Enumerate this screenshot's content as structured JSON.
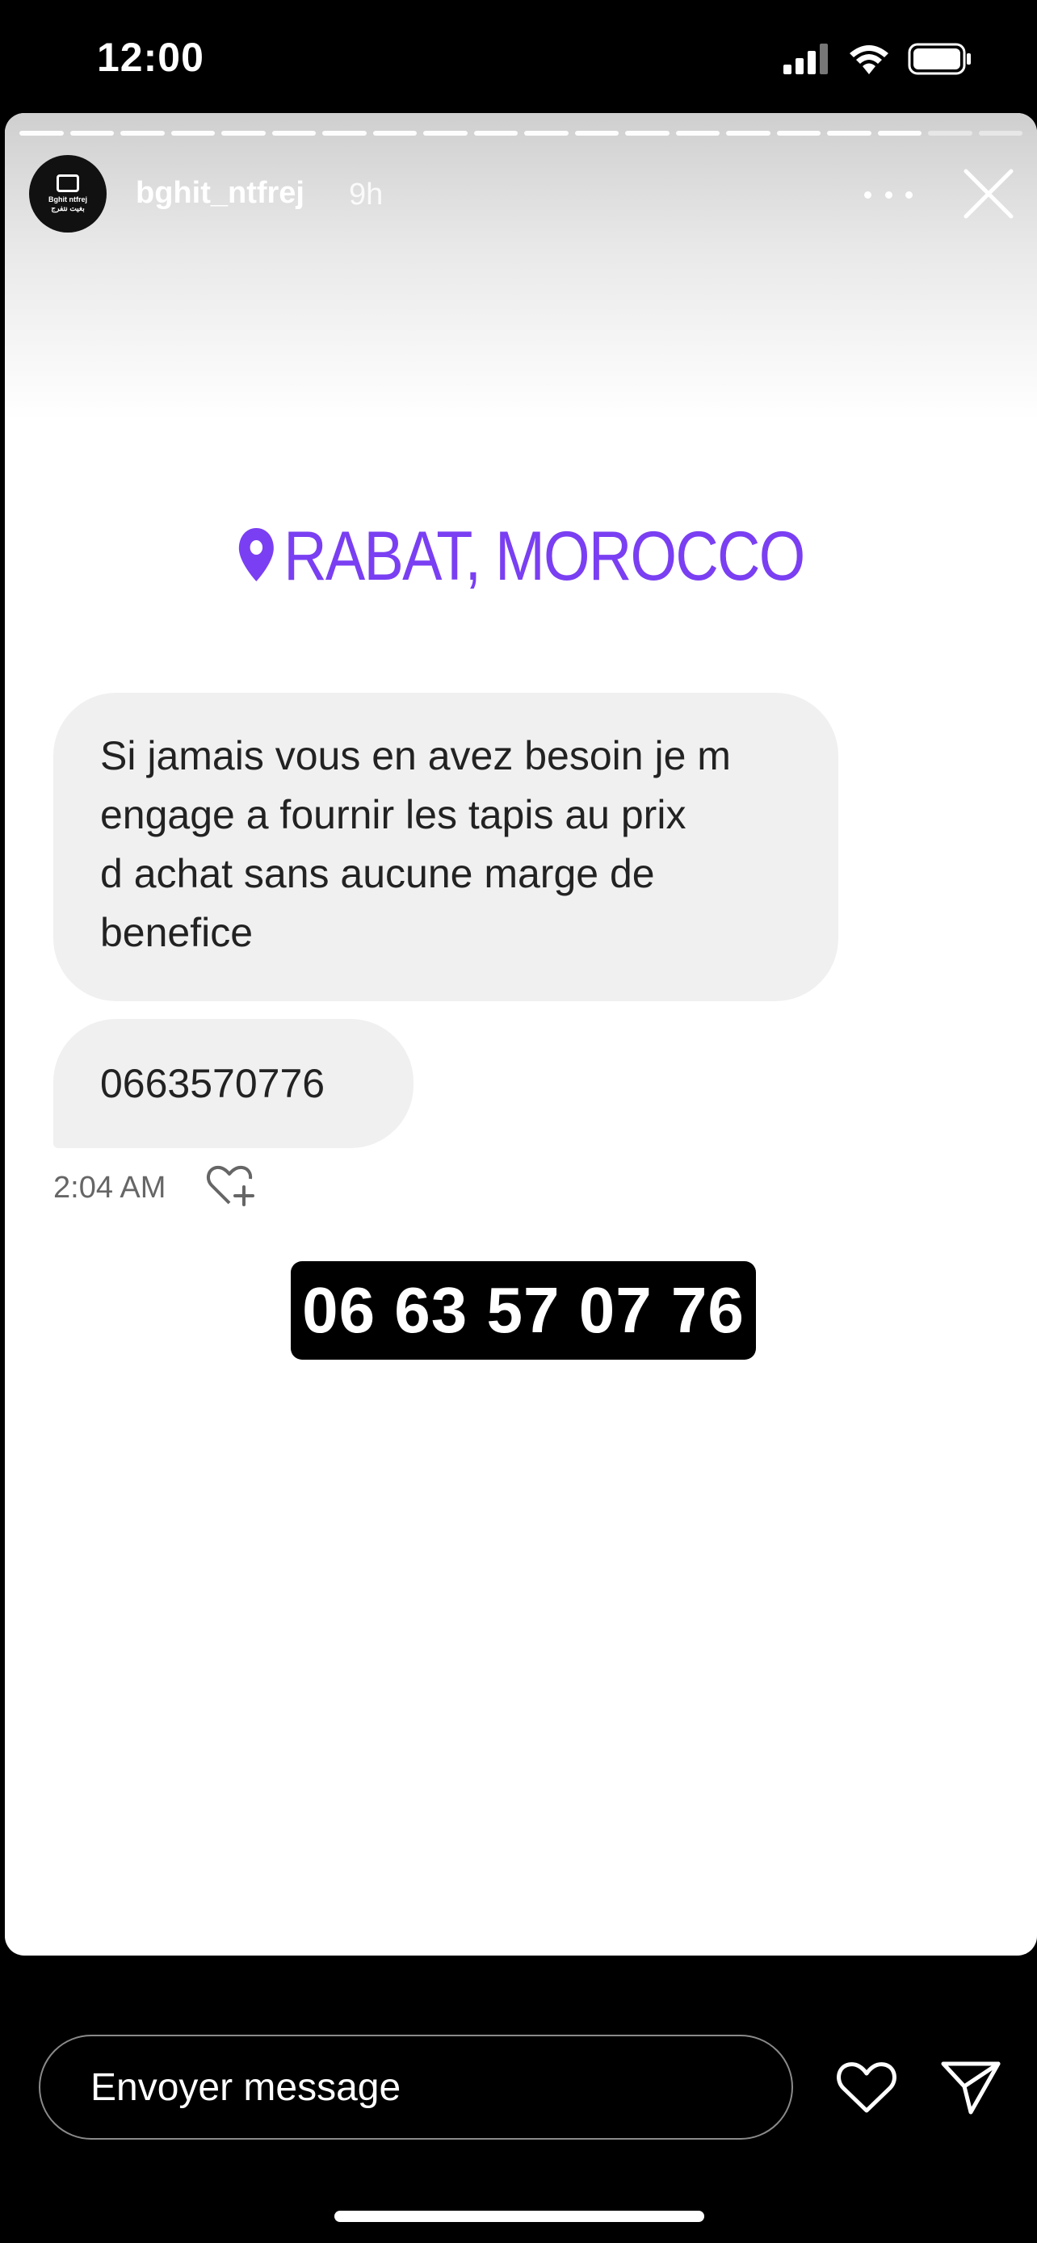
{
  "status_bar": {
    "time": "12:00",
    "icons": [
      "cellular-signal-icon",
      "wifi-icon",
      "battery-icon"
    ]
  },
  "story": {
    "progress_segments_total": 20,
    "progress_segments_viewed": 18,
    "account": {
      "username": "bghit_ntfrej",
      "time_ago": "9h",
      "avatar_text": "Bghit ntfrej",
      "avatar_text_ar": "بغيت نتفرج"
    },
    "location_sticker": "RABAT, MOROCCO",
    "messages": [
      {
        "text": "Si jamais vous en avez besoin je m\nengage a fournir les tapis au prix\nd achat sans aucune marge de\nbenefice"
      },
      {
        "text": "0663570776"
      }
    ],
    "message_time": "2:04 AM",
    "phone_sticker": "06 63 57 07 76"
  },
  "footer": {
    "message_placeholder": "Envoyer message"
  },
  "colors": {
    "accent_purple": "#7a3ff2",
    "bubble_bg": "#f0f0f0",
    "background": "#000000"
  }
}
